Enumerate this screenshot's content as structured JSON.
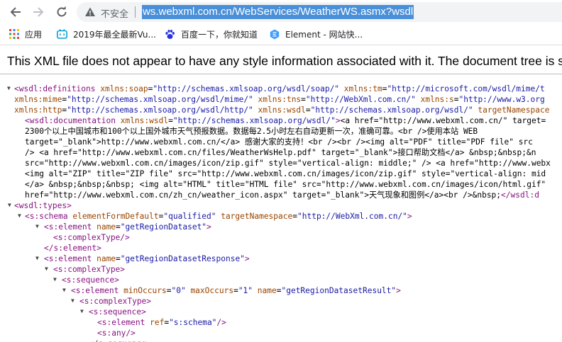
{
  "browser": {
    "security_label": "不安全",
    "url": "ws.webxml.com.cn/WebServices/WeatherWS.asmx?wsdl"
  },
  "bookmarks": [
    {
      "label": "应用",
      "icon": "apps-grid-icon",
      "color": "#e94235"
    },
    {
      "label": "2019年最全最新Vu...",
      "icon": "bilibili-icon",
      "color": "#00a1d6"
    },
    {
      "label": "百度一下，你就知道",
      "icon": "baidu-paw-icon",
      "color": "#2932e1"
    },
    {
      "label": "Element - 网站快...",
      "icon": "element-logo-icon",
      "color": "#409eff"
    }
  ],
  "notice": "This XML file does not appear to have any style information associated with it. The document tree is sh",
  "colors": {
    "tag": "#881280",
    "attr_name": "#994500",
    "attr_value": "#1a1aa6"
  },
  "xml_lines": [
    [
      [
        "t",
        "<wsdl:definitions "
      ],
      [
        "n",
        "xmlns:soap"
      ],
      [
        "p",
        "="
      ],
      [
        "v",
        "\"http://schemas.xmlsoap.org/wsdl/soap/\""
      ],
      [
        "p",
        " "
      ],
      [
        "n",
        "xmlns:tm"
      ],
      [
        "p",
        "="
      ],
      [
        "v",
        "\"http://microsoft.com/wsdl/mime/t"
      ]
    ],
    [
      [
        "n",
        "xmlns:mime"
      ],
      [
        "p",
        "="
      ],
      [
        "v",
        "\"http://schemas.xmlsoap.org/wsdl/mime/\""
      ],
      [
        "p",
        " "
      ],
      [
        "n",
        "xmlns:tns"
      ],
      [
        "p",
        "="
      ],
      [
        "v",
        "\"http://WebXml.com.cn/\""
      ],
      [
        "p",
        " "
      ],
      [
        "n",
        "xmlns:s"
      ],
      [
        "p",
        "="
      ],
      [
        "v",
        "\"http://www.w3.org"
      ]
    ],
    [
      [
        "n",
        "xmlns:http"
      ],
      [
        "p",
        "="
      ],
      [
        "v",
        "\"http://schemas.xmlsoap.org/wsdl/http/\""
      ],
      [
        "p",
        " "
      ],
      [
        "n",
        "xmlns:wsdl"
      ],
      [
        "p",
        "="
      ],
      [
        "v",
        "\"http://schemas.xmlsoap.org/wsdl/\""
      ],
      [
        "p",
        " "
      ],
      [
        "n",
        "targetNamespace"
      ]
    ],
    [
      [
        "t",
        "<wsdl:documentation "
      ],
      [
        "n",
        "xmlns:wsdl"
      ],
      [
        "p",
        "="
      ],
      [
        "v",
        "\"http://schemas.xmlsoap.org/wsdl/\""
      ],
      [
        "t",
        ">"
      ],
      [
        "p",
        "<a href=\"http://www.webxml.com.cn/\" target="
      ]
    ],
    [
      [
        "p",
        "2300个以上中国城市和100个以上国外城市天气预报数据。数据每2.5小时左右自动更新一次，准确可靠。<br />使用本站 WEB"
      ]
    ],
    [
      [
        "p",
        "target=\"_blank\">http://www.webxml.com.cn/</a> 感谢大家的支持！<br /><br /><img alt=\"PDF\" title=\"PDF file\" src"
      ]
    ],
    [
      [
        "p",
        "/> <a href=\"http://www.webxml.com.cn/files/WeatherWsHelp.pdf\" target=\"_blank\">接口帮助文档</a> &nbsp;&nbsp;&n"
      ]
    ],
    [
      [
        "p",
        "src=\"http://www.webxml.com.cn/images/icon/zip.gif\" style=\"vertical-align: middle;\" /> <a href=\"http://www.webx"
      ]
    ],
    [
      [
        "p",
        "<img alt=\"ZIP\" title=\"ZIP file\" src=\"http://www.webxml.com.cn/images/icon/zip.gif\" style=\"vertical-align: mid"
      ]
    ],
    [
      [
        "p",
        "</a> &nbsp;&nbsp;&nbsp; <img alt=\"HTML\" title=\"HTML file\" src=\"http://www.webxml.com.cn/images/icon/html.gif\""
      ]
    ],
    [
      [
        "p",
        "href=\"http://www.webxml.com.cn/zh_cn/weather_icon.aspx\" target=\"_blank\">天气现象和图例</a><br />&nbsp;"
      ],
      [
        "t",
        "</wsdl:d"
      ]
    ],
    [
      [
        "t",
        "<wsdl:types>"
      ]
    ],
    [
      [
        "t",
        "<s:schema "
      ],
      [
        "n",
        "elementFormDefault"
      ],
      [
        "p",
        "="
      ],
      [
        "v",
        "\"qualified\""
      ],
      [
        "p",
        " "
      ],
      [
        "n",
        "targetNamespace"
      ],
      [
        "p",
        "="
      ],
      [
        "v",
        "\"http://WebXml.com.cn/\""
      ],
      [
        "t",
        ">"
      ]
    ],
    [
      [
        "t",
        "<s:element "
      ],
      [
        "n",
        "name"
      ],
      [
        "p",
        "="
      ],
      [
        "v",
        "\"getRegionDataset\""
      ],
      [
        "t",
        ">"
      ]
    ],
    [
      [
        "t",
        "<s:complexType/>"
      ]
    ],
    [
      [
        "t",
        "</s:element>"
      ]
    ],
    [
      [
        "t",
        "<s:element "
      ],
      [
        "n",
        "name"
      ],
      [
        "p",
        "="
      ],
      [
        "v",
        "\"getRegionDatasetResponse\""
      ],
      [
        "t",
        ">"
      ]
    ],
    [
      [
        "t",
        "<s:complexType>"
      ]
    ],
    [
      [
        "t",
        "<s:sequence>"
      ]
    ],
    [
      [
        "t",
        "<s:element "
      ],
      [
        "n",
        "minOccurs"
      ],
      [
        "p",
        "="
      ],
      [
        "v",
        "\"0\""
      ],
      [
        "p",
        " "
      ],
      [
        "n",
        "maxOccurs"
      ],
      [
        "p",
        "="
      ],
      [
        "v",
        "\"1\""
      ],
      [
        "p",
        " "
      ],
      [
        "n",
        "name"
      ],
      [
        "p",
        "="
      ],
      [
        "v",
        "\"getRegionDatasetResult\""
      ],
      [
        "t",
        ">"
      ]
    ],
    [
      [
        "t",
        "<s:complexType>"
      ]
    ],
    [
      [
        "t",
        "<s:sequence>"
      ]
    ],
    [
      [
        "t",
        "<s:element "
      ],
      [
        "n",
        "ref"
      ],
      [
        "p",
        "="
      ],
      [
        "v",
        "\"s:schema\""
      ],
      [
        "t",
        "/>"
      ]
    ],
    [
      [
        "t",
        "<s:any/>"
      ]
    ],
    [
      [
        "t",
        "</s:sequence>"
      ]
    ]
  ]
}
